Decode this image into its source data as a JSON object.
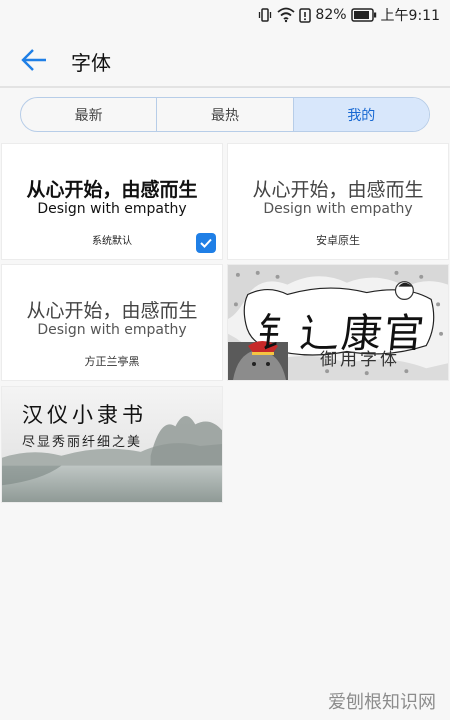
{
  "status_bar": {
    "battery": "82%",
    "time": "上午9:11",
    "icons": [
      "vibrate-icon",
      "wifi-icon",
      "alert-icon",
      "battery-icon"
    ]
  },
  "app_bar": {
    "title": "字体",
    "back_icon": "arrow-left-icon"
  },
  "tabs": [
    {
      "label": "最新",
      "active": false
    },
    {
      "label": "最热",
      "active": false
    },
    {
      "label": "我的",
      "active": true
    }
  ],
  "fonts": [
    {
      "sample_line1": "从心开始，由感而生",
      "sample_line2": "Design with empathy",
      "name": "系统默认",
      "selected": true
    },
    {
      "sample_line1": "从心开始，由感而生",
      "sample_line2": "Design with empathy",
      "name": "安卓原生",
      "selected": false
    },
    {
      "sample_line1": "从心开始，由感而生",
      "sample_line2": "Design with empathy",
      "name": "方正兰亭黑",
      "selected": false
    },
    {
      "sample_line1": "钅辶康官",
      "sample_line2": "御用字体",
      "selected": false
    },
    {
      "sample_line1": "汉仪小隶书",
      "sample_line2": "尽显秀丽纤细之美",
      "selected": false
    }
  ],
  "watermark": "爱刨根知识网",
  "colors": {
    "accent": "#1f7fe6",
    "tab_active_bg": "#d8e7fb",
    "tab_border": "#b7cde8"
  }
}
